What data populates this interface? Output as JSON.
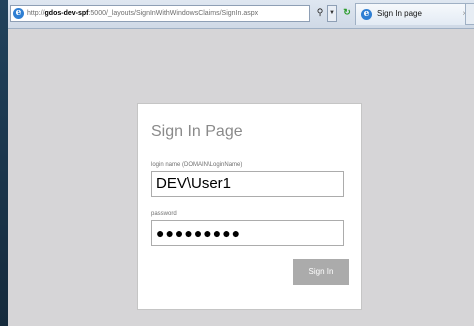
{
  "browser": {
    "address": {
      "scheme": "http://",
      "host": "gdos-dev-spf",
      "path": ":5000/_layouts/SignInWithWindowsClaims/SignIn.aspx"
    },
    "tab": {
      "title": "Sign In page",
      "close": "×"
    }
  },
  "signin": {
    "title": "Sign In Page",
    "login_label": "login name (DOMAIN\\LoginName)",
    "login_value": "DEV\\User1",
    "password_label": "password",
    "password_value": "●●●●●●●●●",
    "button_label": "Sign In"
  },
  "icons": [
    "ie-icon",
    "search-icon",
    "dropdown-arrow-icon",
    "refresh-icon"
  ]
}
